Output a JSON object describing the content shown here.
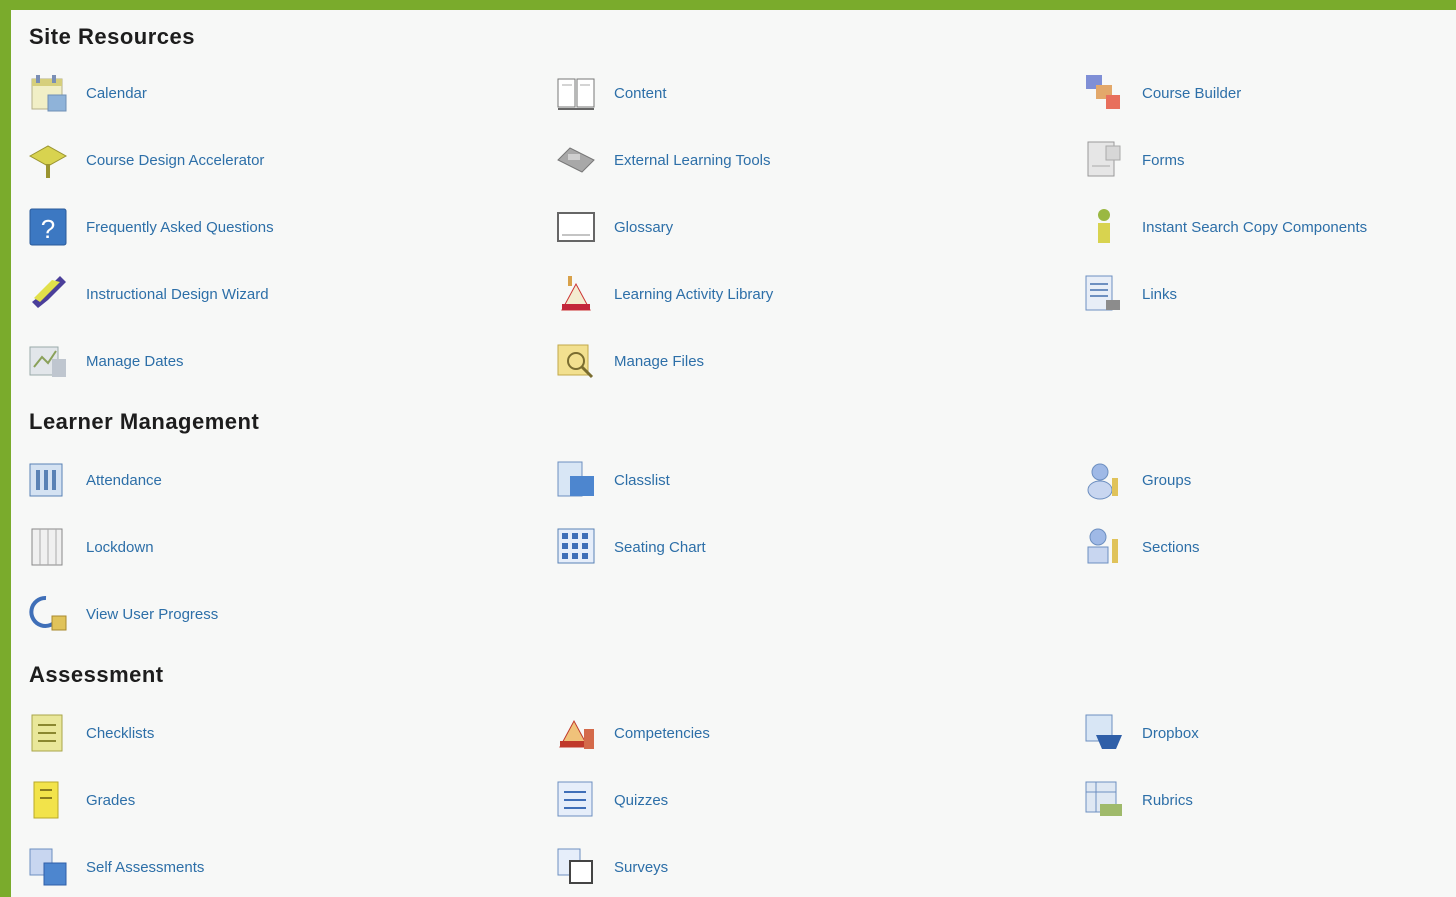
{
  "sections": [
    {
      "title": "Site Resources",
      "items": [
        {
          "label": "Calendar",
          "icon": "calendar-icon"
        },
        {
          "label": "Content",
          "icon": "content-book-icon"
        },
        {
          "label": "Course Builder",
          "icon": "course-builder-icon"
        },
        {
          "label": "Course Design Accelerator",
          "icon": "design-accelerator-icon"
        },
        {
          "label": "External Learning Tools",
          "icon": "external-tools-icon"
        },
        {
          "label": "Forms",
          "icon": "forms-icon"
        },
        {
          "label": "Frequently Asked Questions",
          "icon": "faq-icon"
        },
        {
          "label": "Glossary",
          "icon": "glossary-icon"
        },
        {
          "label": "Instant Search Copy Components",
          "icon": "copy-components-icon"
        },
        {
          "label": "Instructional Design Wizard",
          "icon": "design-wizard-icon"
        },
        {
          "label": "Learning Activity Library",
          "icon": "activity-library-icon"
        },
        {
          "label": "Links",
          "icon": "links-icon"
        },
        {
          "label": "Manage Dates",
          "icon": "manage-dates-icon"
        },
        {
          "label": "Manage Files",
          "icon": "manage-files-icon"
        }
      ]
    },
    {
      "title": "Learner Management",
      "items": [
        {
          "label": "Attendance",
          "icon": "attendance-icon"
        },
        {
          "label": "Classlist",
          "icon": "classlist-icon"
        },
        {
          "label": "Groups",
          "icon": "groups-icon"
        },
        {
          "label": "Lockdown",
          "icon": "lockdown-icon"
        },
        {
          "label": "Seating Chart",
          "icon": "seating-chart-icon"
        },
        {
          "label": "Sections",
          "icon": "sections-icon"
        },
        {
          "label": "View User Progress",
          "icon": "user-progress-icon"
        }
      ]
    },
    {
      "title": "Assessment",
      "items": [
        {
          "label": "Checklists",
          "icon": "checklist-icon"
        },
        {
          "label": "Competencies",
          "icon": "competencies-icon"
        },
        {
          "label": "Dropbox",
          "icon": "dropbox-icon"
        },
        {
          "label": "Grades",
          "icon": "grades-icon"
        },
        {
          "label": "Quizzes",
          "icon": "quizzes-icon"
        },
        {
          "label": "Rubrics",
          "icon": "rubrics-icon"
        },
        {
          "label": "Self Assessments",
          "icon": "self-assessment-icon"
        },
        {
          "label": "Surveys",
          "icon": "surveys-icon"
        }
      ]
    }
  ]
}
